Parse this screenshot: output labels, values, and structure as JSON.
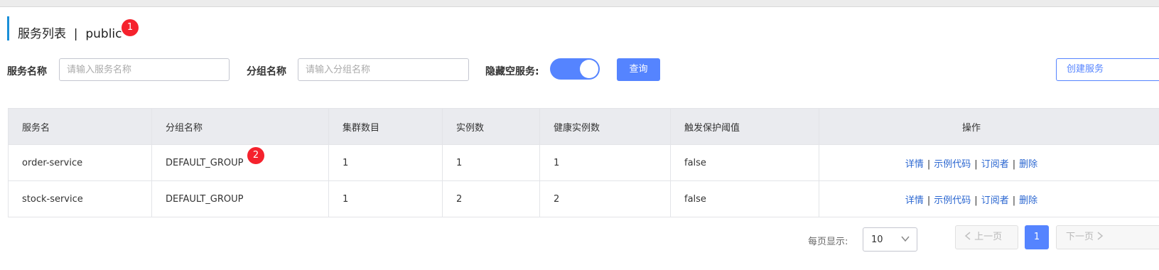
{
  "header": {
    "title": "服务列表  |  public",
    "badge1": "1"
  },
  "filters": {
    "service_name_label": "服务名称",
    "service_name_placeholder": "请输入服务名称",
    "group_name_label": "分组名称",
    "group_name_placeholder": "请输入分组名称",
    "hide_empty_label": "隐藏空服务:",
    "hide_empty_on": true,
    "query_button": "查询",
    "create_button": "创建服务"
  },
  "table": {
    "columns": [
      "服务名",
      "分组名称",
      "集群数目",
      "实例数",
      "健康实例数",
      "触发保护阈值",
      "操作"
    ],
    "rows": [
      {
        "service": "order-service",
        "group": "DEFAULT_GROUP",
        "clusters": "1",
        "instances": "1",
        "healthy": "1",
        "protect": "false",
        "badge": "2"
      },
      {
        "service": "stock-service",
        "group": "DEFAULT_GROUP",
        "clusters": "1",
        "instances": "2",
        "healthy": "2",
        "protect": "false"
      }
    ],
    "ops": {
      "detail": "详情",
      "sample_code": "示例代码",
      "subscribers": "订阅者",
      "delete": "删除",
      "separator": "|"
    }
  },
  "pagination": {
    "page_size_label": "每页显示:",
    "page_size": "10",
    "prev": "上一页",
    "current_page": "1",
    "next": "下一页"
  },
  "colors": {
    "primary": "#5584ff",
    "link": "#2b67d1",
    "badge": "#f5222d",
    "accent_bar": "#1a8fd8"
  }
}
